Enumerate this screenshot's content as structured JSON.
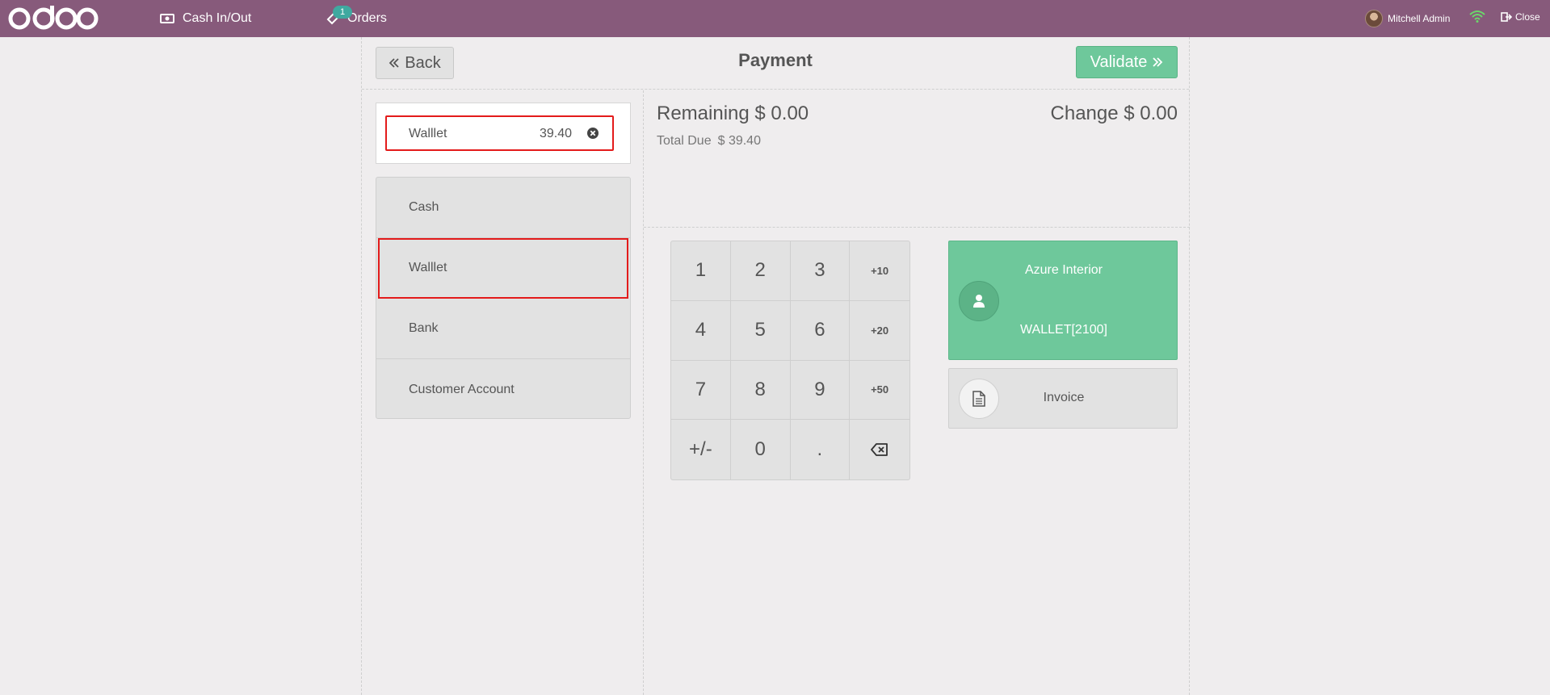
{
  "topbar": {
    "logo_text": "odoo",
    "cash_inout_label": "Cash In/Out",
    "orders_label": "Orders",
    "orders_badge": "1",
    "user_name": "Mitchell Admin",
    "close_label": "Close",
    "bg_color": "#875a7b"
  },
  "payment": {
    "back_label": "Back",
    "title": "Payment",
    "validate_label": "Validate",
    "accent_color": "#6ec89b"
  },
  "paymentlines": [
    {
      "name": "Walllet",
      "amount": "39.40"
    }
  ],
  "methods": [
    {
      "label": "Cash"
    },
    {
      "label": "Walllet"
    },
    {
      "label": "Bank"
    },
    {
      "label": "Customer Account"
    }
  ],
  "status": {
    "remaining_label": "Remaining",
    "remaining_value": "$ 0.00",
    "change_label": "Change",
    "change_value": "$ 0.00",
    "total_due_label": "Total Due",
    "total_due_value": "$ 39.40"
  },
  "numpad": {
    "keys": [
      "1",
      "2",
      "3",
      "+10",
      "4",
      "5",
      "6",
      "+20",
      "7",
      "8",
      "9",
      "+50",
      "+/-",
      "0",
      "."
    ]
  },
  "customer": {
    "name": "Azure Interior",
    "wallet": "WALLET[2100]"
  },
  "invoice_label": "Invoice",
  "icons": {
    "back": "double-chevron-left-icon",
    "validate": "double-chevron-right-icon",
    "delete": "circle-x-icon",
    "backspace": "backspace-icon",
    "user": "user-icon",
    "invoice": "document-icon",
    "wifi": "wifi-icon",
    "close": "sign-out-icon",
    "cash": "money-icon",
    "orders": "tag-icon"
  }
}
